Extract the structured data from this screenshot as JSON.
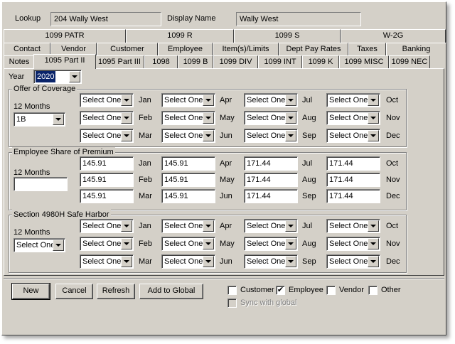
{
  "header": {
    "lookup_label": "Lookup",
    "lookup_value": "204 Wally West",
    "display_name_label": "Display Name",
    "display_name_value": "Wally West"
  },
  "tabs": {
    "row1": [
      "1099 PATR",
      "1099 R",
      "1099 S",
      "W-2G"
    ],
    "row2": [
      "Contact",
      "Vendor",
      "Customer",
      "Employee",
      "Item(s)/Limits",
      "Dept Pay Rates",
      "Taxes",
      "Banking"
    ],
    "row3": [
      "Notes",
      "1095 Part II",
      "1095 Part III",
      "1098",
      "1099 B",
      "1099 DIV",
      "1099 INT",
      "1099 K",
      "1099 MISC",
      "1099 NEC"
    ],
    "active": "1095 Part II"
  },
  "year": {
    "label": "Year",
    "value": "2020"
  },
  "months": [
    "Jan",
    "Feb",
    "Mar",
    "Apr",
    "May",
    "Jun",
    "Jul",
    "Aug",
    "Sep",
    "Oct",
    "Nov",
    "Dec"
  ],
  "offer_of_coverage": {
    "title": "Offer of Coverage",
    "twelve_months_label": "12 Months",
    "twelve_months_value": "1B",
    "values": [
      "Select One",
      "Select One",
      "Select One",
      "Select One",
      "Select One",
      "Select One",
      "Select One",
      "Select One",
      "Select One",
      "Select One",
      "Select One",
      "Select One"
    ]
  },
  "employee_share": {
    "title": "Employee Share of Premium",
    "twelve_months_label": "12 Months",
    "twelve_months_value": "",
    "values": [
      "145.91",
      "145.91",
      "145.91",
      "145.91",
      "145.91",
      "145.91",
      "171.44",
      "171.44",
      "171.44",
      "171.44",
      "171.44",
      "171.44"
    ]
  },
  "safe_harbor": {
    "title": "Section 4980H Safe Harbor",
    "twelve_months_label": "12 Months",
    "twelve_months_value": "Select One",
    "values": [
      "Select One",
      "Select One",
      "Select One",
      "Select One",
      "Select One",
      "Select One",
      "Select One",
      "Select One",
      "Select One",
      "Select One",
      "Select One",
      "Select One"
    ]
  },
  "buttons": {
    "new": "New",
    "cancel": "Cancel",
    "refresh": "Refresh",
    "add_to_global": "Add to Global"
  },
  "checkboxes": {
    "customer": {
      "label": "Customer",
      "checked": false
    },
    "employee": {
      "label": "Employee",
      "checked": true
    },
    "vendor": {
      "label": "Vendor",
      "checked": false
    },
    "other": {
      "label": "Other",
      "checked": false
    },
    "sync": {
      "label": "Sync with global",
      "checked": false
    }
  },
  "colors": {
    "face": "#d4d0c8",
    "highlight": "#0a246a",
    "shadow": "#808080"
  }
}
